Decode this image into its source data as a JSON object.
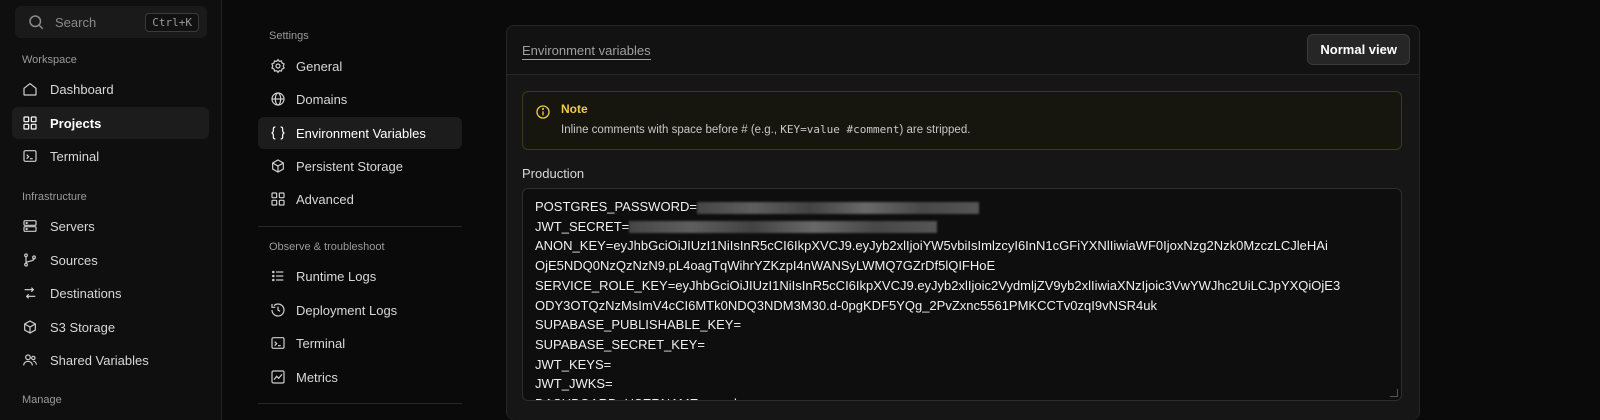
{
  "search": {
    "placeholder": "Search",
    "shortcut": "Ctrl+K"
  },
  "sidebar": {
    "sections": [
      {
        "label": "Workspace"
      },
      {
        "label": "Infrastructure"
      },
      {
        "label": "Manage"
      }
    ],
    "items": [
      {
        "label": "Dashboard",
        "icon": "home-icon"
      },
      {
        "label": "Projects",
        "icon": "grid-icon",
        "active": true
      },
      {
        "label": "Terminal",
        "icon": "terminal-icon"
      },
      {
        "label": "Servers",
        "icon": "server-icon"
      },
      {
        "label": "Sources",
        "icon": "git-branch-icon"
      },
      {
        "label": "Destinations",
        "icon": "destinations-icon"
      },
      {
        "label": "S3 Storage",
        "icon": "box-icon"
      },
      {
        "label": "Shared Variables",
        "icon": "users-icon"
      }
    ]
  },
  "settings_nav": {
    "header": "Settings",
    "observe_header": "Observe & troubleshoot",
    "items": [
      {
        "label": "General",
        "icon": "gear-icon"
      },
      {
        "label": "Domains",
        "icon": "globe-icon"
      },
      {
        "label": "Environment Variables",
        "icon": "braces-icon",
        "active": true
      },
      {
        "label": "Persistent Storage",
        "icon": "box-icon"
      },
      {
        "label": "Advanced",
        "icon": "grid-icon"
      },
      {
        "label": "Runtime Logs",
        "icon": "list-icon"
      },
      {
        "label": "Deployment Logs",
        "icon": "history-icon"
      },
      {
        "label": "Terminal",
        "icon": "terminal-icon"
      },
      {
        "label": "Metrics",
        "icon": "chart-icon"
      }
    ]
  },
  "main": {
    "title": "Environment variables",
    "normal_view_label": "Normal view",
    "note": {
      "title": "Note",
      "text_before": "Inline comments with space before # (e.g., ",
      "text_code": "KEY=value #comment",
      "text_after": ") are stripped."
    },
    "production_label": "Production",
    "env_lines": [
      "POSTGRES_PASSWORD=",
      "JWT_SECRET=",
      "ANON_KEY=eyJhbGciOiJIUzI1NiIsInR5cCI6IkpXVCJ9.eyJyb2xlIjoiYW5vbiIsImlzcyI6InN1cGFiYXNlIiwiaWF0IjoxNzg2Nzk0MzczLCJleHAi",
      "OjE5NDQ0NzQzNzN9.pL4oagTqWihrYZKzpI4nWANSyLWMQ7GZrDf5lQIFHoE",
      "SERVICE_ROLE_KEY=eyJhbGciOiJIUzI1NiIsInR5cCI6IkpXVCJ9.eyJyb2xlIjoic2VydmljZV9yb2xlIiwiaXNzIjoic3VwYWJhc2UiLCJpYXQiOjE3",
      "ODY3OTQzNzMsImV4cCI6MTk0NDQ3NDM3M30.d-0pgKDF5YQg_2PvZxnc5561PMKCCTv0zqI9vNSR4uk",
      "SUPABASE_PUBLISHABLE_KEY=",
      "SUPABASE_SECRET_KEY=",
      "JWT_KEYS=",
      "JWT_JWKS=",
      "DASHBOARD_USERNAME=supabase"
    ],
    "redacted_lines": [
      0,
      1
    ]
  }
}
